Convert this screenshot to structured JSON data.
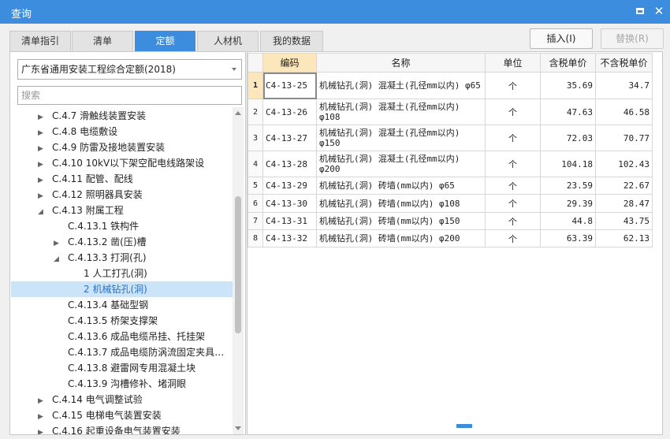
{
  "window": {
    "title": "查询"
  },
  "tabs": [
    "清单指引",
    "清单",
    "定额",
    "人材机",
    "我的数据"
  ],
  "active_tab": 2,
  "buttons": {
    "insert": "插入(I)",
    "replace": "替换(R)"
  },
  "selector": {
    "value": "广东省通用安装工程综合定额(2018)"
  },
  "search": {
    "placeholder": "搜索"
  },
  "tree": [
    {
      "label": "C.4.7 滑触线装置安装",
      "indent": 0,
      "arrow": "right"
    },
    {
      "label": "C.4.8 电缆敷设",
      "indent": 0,
      "arrow": "right"
    },
    {
      "label": "C.4.9 防雷及接地装置安装",
      "indent": 0,
      "arrow": "right"
    },
    {
      "label": "C.4.10 10kV以下架空配电线路架设",
      "indent": 0,
      "arrow": "right"
    },
    {
      "label": "C.4.11 配管、配线",
      "indent": 0,
      "arrow": "right"
    },
    {
      "label": "C.4.12 照明器具安装",
      "indent": 0,
      "arrow": "right"
    },
    {
      "label": "C.4.13 附属工程",
      "indent": 0,
      "arrow": "down"
    },
    {
      "label": "C.4.13.1 铁构件",
      "indent": 1,
      "arrow": ""
    },
    {
      "label": "C.4.13.2 凿(压)槽",
      "indent": 1,
      "arrow": "right"
    },
    {
      "label": "C.4.13.3 打洞(孔)",
      "indent": 1,
      "arrow": "down"
    },
    {
      "label": "1 人工打孔(洞)",
      "indent": 2,
      "arrow": ""
    },
    {
      "label": "2 机械钻孔(洞)",
      "indent": 2,
      "arrow": "",
      "selected": true
    },
    {
      "label": "C.4.13.4 基础型钢",
      "indent": 1,
      "arrow": ""
    },
    {
      "label": "C.4.13.5 桥架支撑架",
      "indent": 1,
      "arrow": ""
    },
    {
      "label": "C.4.13.6 成品电缆吊挂、托挂架",
      "indent": 1,
      "arrow": ""
    },
    {
      "label": "C.4.13.7 成品电缆防涡流固定夹具、...",
      "indent": 1,
      "arrow": ""
    },
    {
      "label": "C.4.13.8 避雷网专用混凝土块",
      "indent": 1,
      "arrow": ""
    },
    {
      "label": "C.4.13.9 沟槽修补、堵洞眼",
      "indent": 1,
      "arrow": ""
    },
    {
      "label": "C.4.14 电气调整试验",
      "indent": 0,
      "arrow": "right"
    },
    {
      "label": "C.4.15 电梯电气装置安装",
      "indent": 0,
      "arrow": "right"
    },
    {
      "label": "C.4.16 起重设备电气装置安装",
      "indent": 0,
      "arrow": "right"
    }
  ],
  "table": {
    "headers": [
      "编码",
      "名称",
      "单位",
      "含税单价",
      "不含税单价"
    ],
    "rows": [
      {
        "no": "1",
        "code": "C4-13-25",
        "name": "机械钻孔(洞) 混凝土(孔径mm以内) φ65",
        "unit": "个",
        "price_tax": "35.69",
        "price_notax": "34.7"
      },
      {
        "no": "2",
        "code": "C4-13-26",
        "name": "机械钻孔(洞) 混凝土(孔径mm以内) φ108",
        "unit": "个",
        "price_tax": "47.63",
        "price_notax": "46.58"
      },
      {
        "no": "3",
        "code": "C4-13-27",
        "name": "机械钻孔(洞) 混凝土(孔径mm以内) φ150",
        "unit": "个",
        "price_tax": "72.03",
        "price_notax": "70.77"
      },
      {
        "no": "4",
        "code": "C4-13-28",
        "name": "机械钻孔(洞) 混凝土(孔径mm以内) φ200",
        "unit": "个",
        "price_tax": "104.18",
        "price_notax": "102.43"
      },
      {
        "no": "5",
        "code": "C4-13-29",
        "name": "机械钻孔(洞) 砖墙(mm以内) φ65",
        "unit": "个",
        "price_tax": "23.59",
        "price_notax": "22.67"
      },
      {
        "no": "6",
        "code": "C4-13-30",
        "name": "机械钻孔(洞) 砖墙(mm以内) φ108",
        "unit": "个",
        "price_tax": "29.39",
        "price_notax": "28.47"
      },
      {
        "no": "7",
        "code": "C4-13-31",
        "name": "机械钻孔(洞) 砖墙(mm以内) φ150",
        "unit": "个",
        "price_tax": "44.8",
        "price_notax": "43.75"
      },
      {
        "no": "8",
        "code": "C4-13-32",
        "name": "机械钻孔(洞) 砖墙(mm以内) φ200",
        "unit": "个",
        "price_tax": "63.39",
        "price_notax": "62.13"
      }
    ]
  }
}
